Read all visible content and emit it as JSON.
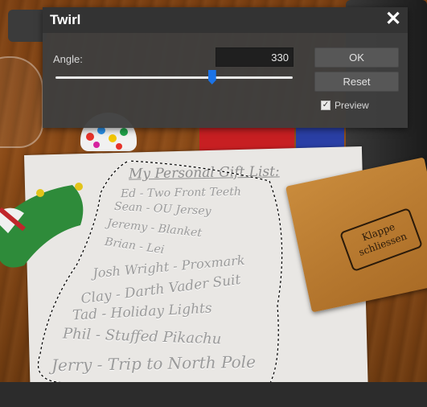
{
  "dialog": {
    "title": "Twirl",
    "close_icon": "close-icon",
    "angle_label": "Angle:",
    "angle_value": "330",
    "slider_level_percent": 66,
    "ok_label": "OK",
    "reset_label": "Reset",
    "preview_label": "Preview",
    "preview_checked": true
  },
  "photo": {
    "gift_list_title": "My Personal Gift List:",
    "gift_lines": [
      "Ed - Two Front Teeth",
      "Sean - OU Jersey",
      "Jeremy - Blanket",
      "Brian - Lei",
      "Josh Wright - Proxmark",
      "Clay - Darth Vader Suit",
      "Tad - Holiday Lights",
      "Phil - Stuffed Pikachu",
      "Jerry - Trip to North Pole"
    ],
    "wood_box_label_line1": "Klappe",
    "wood_box_label_line2": "schliessen"
  },
  "colors": {
    "dialog_bg": "#3e3e3e",
    "slider_thumb": "#1b73e8",
    "accent_red": "#c71f22"
  }
}
